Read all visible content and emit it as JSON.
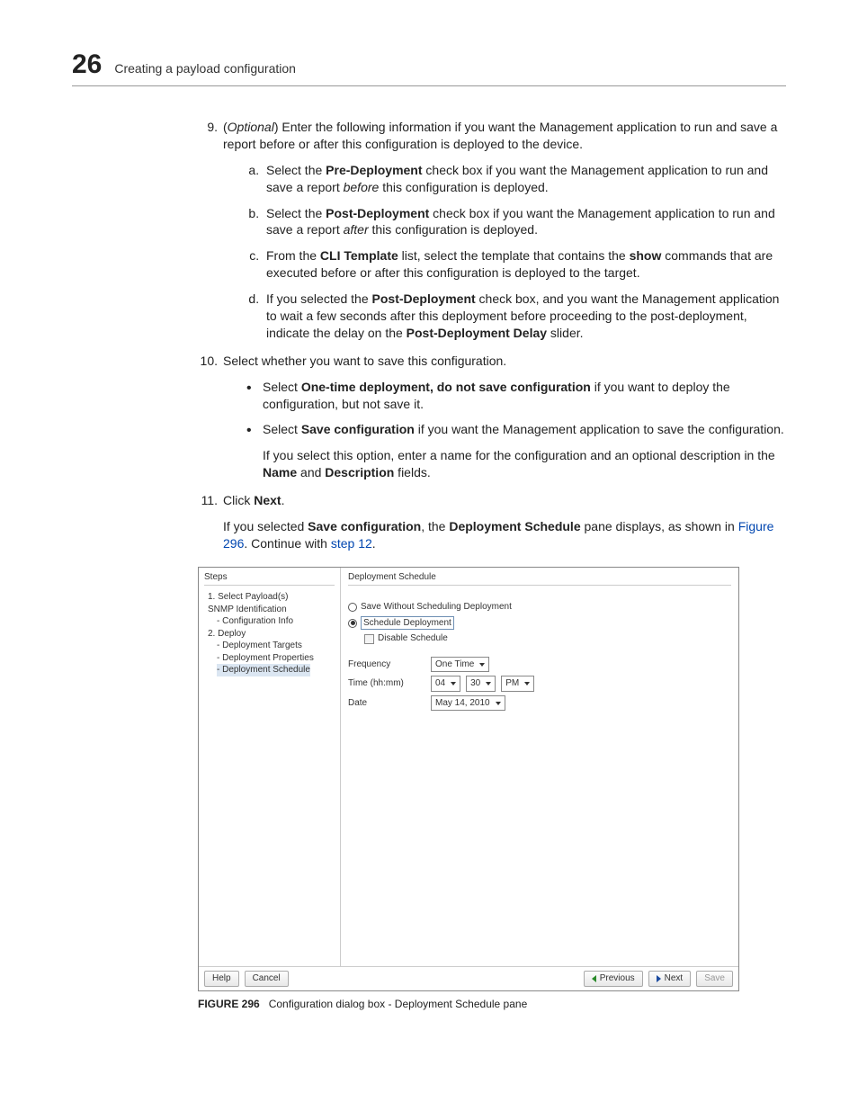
{
  "header": {
    "chapter_no": "26",
    "title": "Creating a payload configuration"
  },
  "steps": {
    "s9": {
      "optional": "Optional",
      "text_after": ") Enter the following information if you want the Management application to run and save a report before or after this configuration is deployed to the device.",
      "a_pre": "Select the ",
      "a_bold": "Pre-Deployment",
      "a_mid": " check box if you want the Management application to run and save a report ",
      "a_ital": "before",
      "a_post": " this configuration is deployed.",
      "b_pre": "Select the ",
      "b_bold": "Post-Deployment",
      "b_mid": " check box if you want the Management application to run and save a report ",
      "b_ital": "after",
      "b_post": " this configuration is deployed.",
      "c_pre": "From the ",
      "c_bold1": "CLI Template",
      "c_mid": " list, select the template that contains the ",
      "c_bold2": "show",
      "c_post": " commands that are executed before or after this configuration is deployed to the target.",
      "d_pre": "If you selected the ",
      "d_bold1": "Post-Deployment",
      "d_mid": " check box, and you want the Management application to wait a few seconds after this deployment before proceeding to the post-deployment, indicate the delay on the ",
      "d_bold2": "Post-Deployment Delay",
      "d_post": " slider."
    },
    "s10": {
      "lead": "Select whether you want to save this configuration.",
      "bul1_pre": "Select ",
      "bul1_bold": "One-time deployment, do not save configuration",
      "bul1_post": " if you want to deploy the configuration, but not save it.",
      "bul2_pre": "Select ",
      "bul2_bold": "Save configuration",
      "bul2_post": " if you want the Management application to save the configuration.",
      "bul2_extra_pre": "If you select this option, enter a name for the configuration and an optional description in the ",
      "bul2_extra_b1": "Name",
      "bul2_extra_mid": " and ",
      "bul2_extra_b2": "Description",
      "bul2_extra_post": " fields."
    },
    "s11": {
      "pre": "Click ",
      "bold": "Next",
      "post": ".",
      "p2_pre": "If you selected ",
      "p2_b1": "Save configuration",
      "p2_mid1": ", the ",
      "p2_b2": "Deployment Schedule",
      "p2_mid2": " pane displays, as shown in ",
      "p2_link1": "Figure 296",
      "p2_mid3": ". Continue with ",
      "p2_link2": "step 12",
      "p2_post": "."
    }
  },
  "dialog": {
    "steps_title": "Steps",
    "tree": {
      "t1": "1. Select Payload(s)",
      "t1a": "SNMP Identification",
      "t1b": "- Configuration Info",
      "t2": "2. Deploy",
      "t2a": "- Deployment Targets",
      "t2b": "- Deployment Properties",
      "t2c": "- Deployment Schedule"
    },
    "right_title": "Deployment Schedule",
    "opt1": "Save Without Scheduling Deployment",
    "opt2": "Schedule Deployment",
    "chk1": "Disable Schedule",
    "row_freq_label": "Frequency",
    "row_freq_val": "One Time",
    "row_time_label": "Time (hh:mm)",
    "row_time_h": "04",
    "row_time_m": "30",
    "row_time_ap": "PM",
    "row_date_label": "Date",
    "row_date_val": "May 14, 2010",
    "btn_help": "Help",
    "btn_cancel": "Cancel",
    "btn_prev": "Previous",
    "btn_next": "Next",
    "btn_save": "Save"
  },
  "caption": {
    "label": "FIGURE 296",
    "text": "Configuration dialog box - Deployment Schedule pane"
  }
}
